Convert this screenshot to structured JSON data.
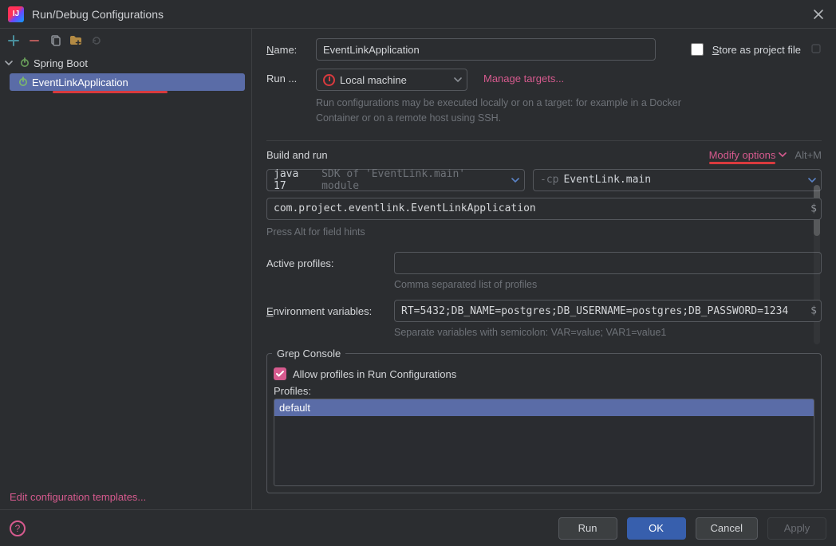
{
  "window": {
    "title": "Run/Debug Configurations"
  },
  "sidebar": {
    "category": "Spring Boot",
    "config": "EventLinkApplication",
    "footer_link": "Edit configuration templates..."
  },
  "form": {
    "name_label": "Name:",
    "name_value": "EventLinkApplication",
    "store_label": "Store as project file",
    "run_on_label": "Run ...",
    "run_on_value": "Local machine",
    "manage_targets": "Manage targets...",
    "run_on_hint": "Run configurations may be executed locally or on a target: for example in a Docker Container or on a remote host using SSH.",
    "build_section": "Build and run",
    "modify_options": "Modify options",
    "modify_shortcut": "Alt+M",
    "java_version": "java 17",
    "sdk_hint": "SDK of 'EventLink.main' module",
    "cp_flag": "-cp",
    "cp_module": "EventLink.main",
    "main_class": "com.project.eventlink.EventLinkApplication",
    "class_hint": "Press Alt for field hints",
    "active_profiles_label": "Active profiles:",
    "active_profiles_value": "",
    "active_profiles_hint": "Comma separated list of profiles",
    "env_label": "Environment variables:",
    "env_value": "RT=5432;DB_NAME=postgres;DB_USERNAME=postgres;DB_PASSWORD=1234",
    "env_hint": "Separate variables with semicolon: VAR=value; VAR1=value1",
    "grep_legend": "Grep Console",
    "allow_profiles": "Allow profiles in Run Configurations",
    "profiles_label": "Profiles:",
    "profile_default": "default"
  },
  "footer": {
    "run": "Run",
    "ok": "OK",
    "cancel": "Cancel",
    "apply": "Apply"
  }
}
